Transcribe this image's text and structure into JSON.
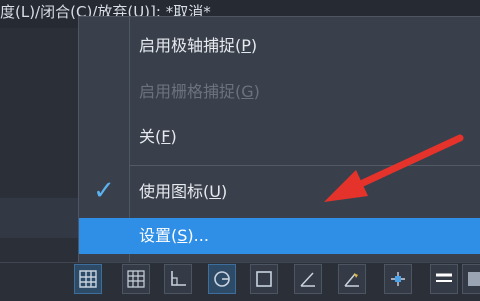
{
  "command_line": {
    "text": "度(L)/闭合(C)/放弃(U)]: *取消*"
  },
  "context_menu": {
    "items": [
      {
        "label": "启用极轴捕捉(",
        "mnemonic": "P",
        "suffix": ")",
        "enabled": true,
        "checked": false,
        "highlighted": false
      },
      {
        "label": "启用栅格捕捉(",
        "mnemonic": "G",
        "suffix": ")",
        "enabled": false,
        "checked": false,
        "highlighted": false
      },
      {
        "label": "关(",
        "mnemonic": "F",
        "suffix": ")",
        "enabled": true,
        "checked": false,
        "highlighted": false
      },
      {
        "label": "使用图标(",
        "mnemonic": "U",
        "suffix": ")",
        "enabled": true,
        "checked": true,
        "highlighted": false
      },
      {
        "label": "设置(",
        "mnemonic": "S",
        "suffix": ")...",
        "enabled": true,
        "checked": false,
        "highlighted": true
      }
    ],
    "check_glyph": "✓"
  },
  "annotation": {
    "arrow_color": "#e5322b"
  },
  "status_bar": {
    "icons": [
      {
        "name": "grid-display-icon",
        "active": true
      },
      {
        "name": "snap-grid-icon",
        "active": false
      },
      {
        "name": "ortho-icon",
        "active": false
      },
      {
        "name": "polar-tracking-icon",
        "active": true
      },
      {
        "name": "object-snap-icon",
        "active": false
      },
      {
        "name": "iso-draft-icon",
        "active": false
      },
      {
        "name": "dynamic-ucs-icon",
        "active": false
      },
      {
        "name": "object-snap-tracking-icon",
        "active": false
      },
      {
        "name": "lineweight-icon",
        "active": false
      },
      {
        "name": "transparency-icon",
        "active": false
      }
    ]
  },
  "colors": {
    "menu_bg": "#3a404b",
    "highlight": "#2f8ee5",
    "check": "#5bb2f0"
  }
}
